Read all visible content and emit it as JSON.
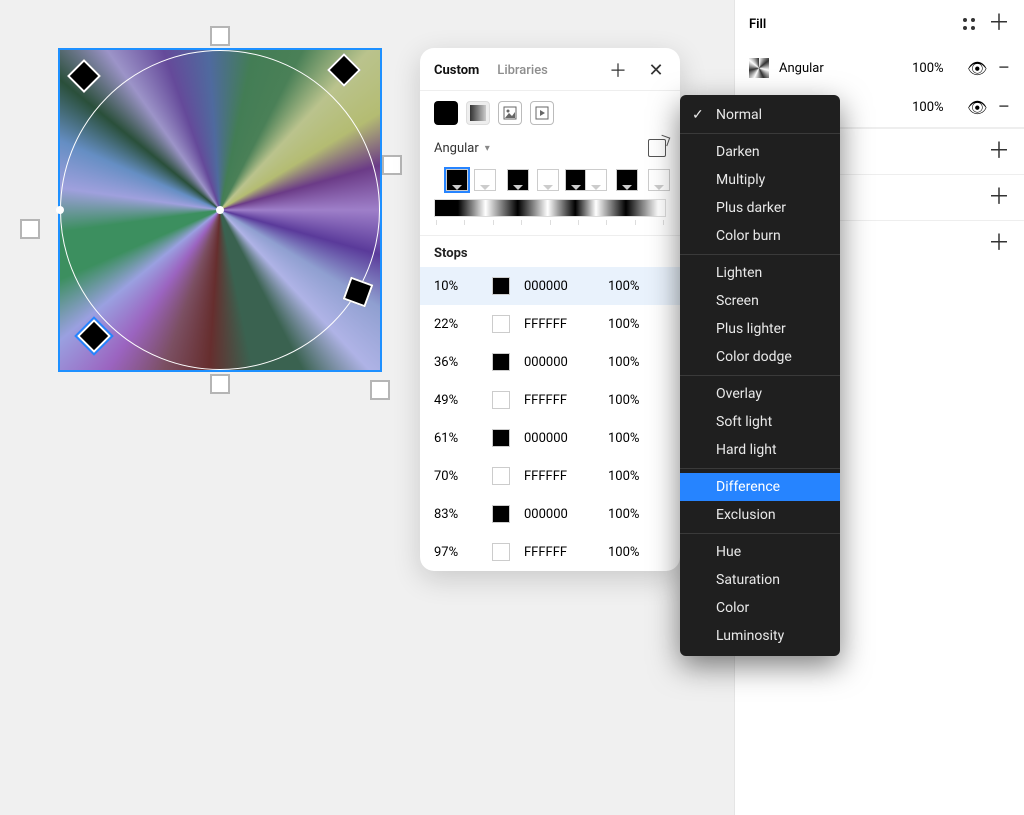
{
  "fill_panel": {
    "title": "Fill",
    "rows": [
      {
        "type": "Angular",
        "opacity": "100%"
      },
      {
        "type": "",
        "opacity": "100%"
      }
    ]
  },
  "popover": {
    "tabs": {
      "custom": "Custom",
      "libraries": "Libraries"
    },
    "gradient_type": "Angular",
    "stops_header": "Stops",
    "stop_thumbs": [
      {
        "pos": 10,
        "filled": true,
        "selected": true
      },
      {
        "pos": 22,
        "filled": false
      },
      {
        "pos": 36,
        "filled": true
      },
      {
        "pos": 49,
        "filled": false
      },
      {
        "pos": 61,
        "filled": true
      },
      {
        "pos": 70,
        "filled": false
      },
      {
        "pos": 83,
        "filled": true
      },
      {
        "pos": 97,
        "filled": false
      }
    ],
    "stops": [
      {
        "position": "10%",
        "hex": "000000",
        "opacity": "100%",
        "black": true,
        "selected": true
      },
      {
        "position": "22%",
        "hex": "FFFFFF",
        "opacity": "100%",
        "black": false
      },
      {
        "position": "36%",
        "hex": "000000",
        "opacity": "100%",
        "black": true
      },
      {
        "position": "49%",
        "hex": "FFFFFF",
        "opacity": "100%",
        "black": false
      },
      {
        "position": "61%",
        "hex": "000000",
        "opacity": "100%",
        "black": true
      },
      {
        "position": "70%",
        "hex": "FFFFFF",
        "opacity": "100%",
        "black": false
      },
      {
        "position": "83%",
        "hex": "000000",
        "opacity": "100%",
        "black": true
      },
      {
        "position": "97%",
        "hex": "FFFFFF",
        "opacity": "100%",
        "black": false
      }
    ]
  },
  "blend_modes": {
    "groups": [
      [
        {
          "label": "Normal",
          "checked": true
        }
      ],
      [
        {
          "label": "Darken"
        },
        {
          "label": "Multiply"
        },
        {
          "label": "Plus darker"
        },
        {
          "label": "Color burn"
        }
      ],
      [
        {
          "label": "Lighten"
        },
        {
          "label": "Screen"
        },
        {
          "label": "Plus lighter"
        },
        {
          "label": "Color dodge"
        }
      ],
      [
        {
          "label": "Overlay"
        },
        {
          "label": "Soft light"
        },
        {
          "label": "Hard light"
        }
      ],
      [
        {
          "label": "Difference",
          "highlight": true
        },
        {
          "label": "Exclusion"
        }
      ],
      [
        {
          "label": "Hue"
        },
        {
          "label": "Saturation"
        },
        {
          "label": "Color"
        },
        {
          "label": "Luminosity"
        }
      ]
    ]
  }
}
